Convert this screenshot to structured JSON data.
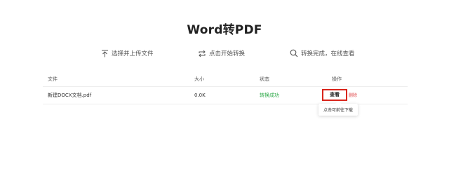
{
  "title": "Word转PDF",
  "steps": [
    {
      "icon": "upload-icon",
      "label": "选择并上传文件"
    },
    {
      "icon": "convert-icon",
      "label": "点击开始转换"
    },
    {
      "icon": "search-icon",
      "label": "转换完成，在线查看"
    }
  ],
  "table": {
    "headers": {
      "file": "文件",
      "size": "大小",
      "status": "状态",
      "actions": "操作"
    },
    "rows": [
      {
        "file": "新建DOCX文档.pdf",
        "size": "0.0K",
        "status": "转换成功",
        "view": "查看",
        "delete": "删除"
      }
    ]
  },
  "tooltip": "点击可前往下载",
  "colors": {
    "success": "#2faa4a",
    "highlight": "#d9251c",
    "delete": "#e0484a"
  }
}
